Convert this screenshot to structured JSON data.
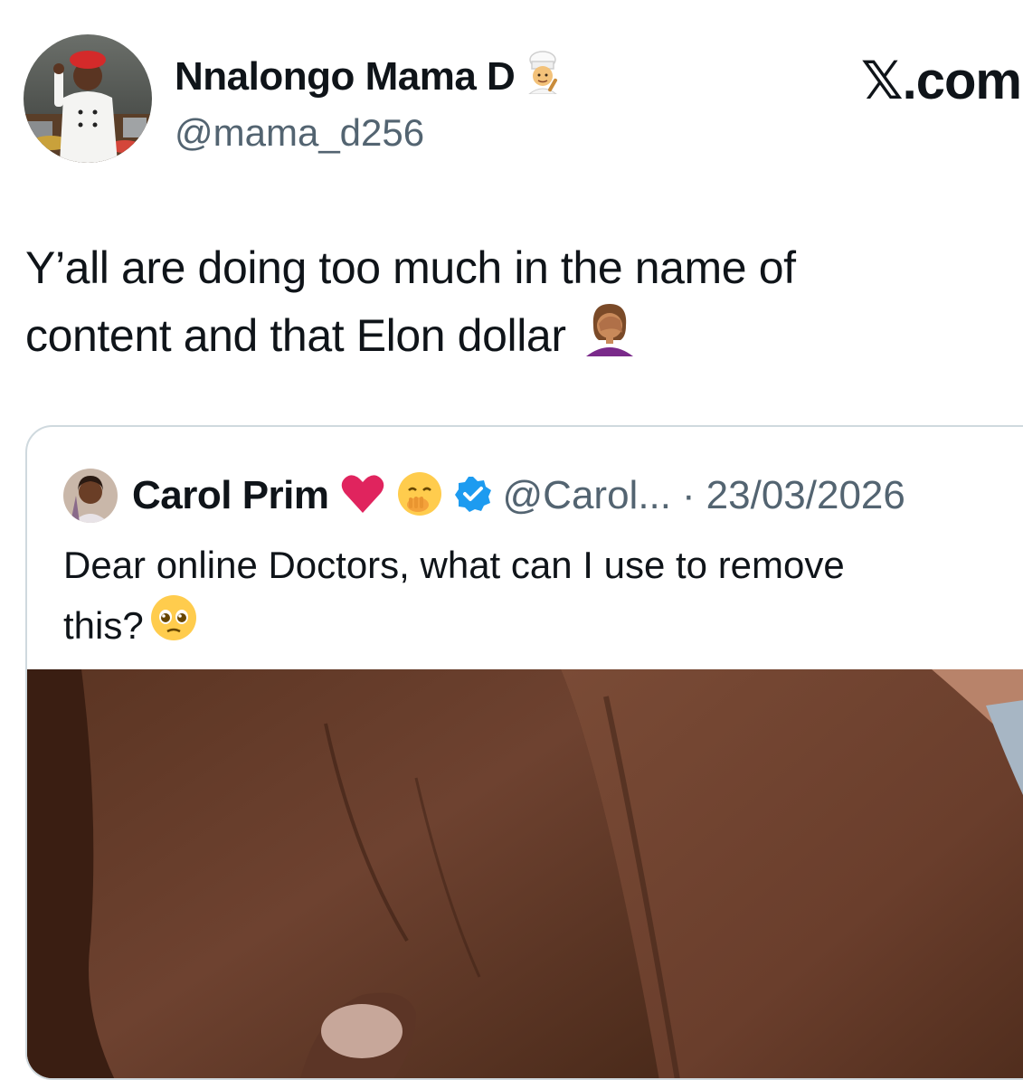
{
  "author": {
    "name": "Nnalongo Mama D",
    "name_emoji": "chef-emoji",
    "handle": "@mama_d256",
    "avatar": "chef-avatar"
  },
  "site_logo": "𝕏.com",
  "tweet": {
    "line1": "Y’all are doing too much in the name of",
    "line2": "content and that Elon dollar",
    "emoji": "woman-facepalming-emoji"
  },
  "quoted": {
    "name": "Carol Prim",
    "emojis": [
      "red-heart-emoji",
      "hand-over-mouth-emoji"
    ],
    "verified_icon": "verified-badge-icon",
    "handle": "@Carol...",
    "separator": "·",
    "date": "23/03/2026",
    "text_line1": "Dear online Doctors, what can I use to remove",
    "text_line2": "this?",
    "text_emoji": "pleading-face-emoji",
    "media": "skin-photo"
  },
  "colors": {
    "text": "#0f1419",
    "secondary": "#536471",
    "border": "#cfd9de",
    "verified": "#1d9bf0",
    "heart": "#e0245e"
  }
}
